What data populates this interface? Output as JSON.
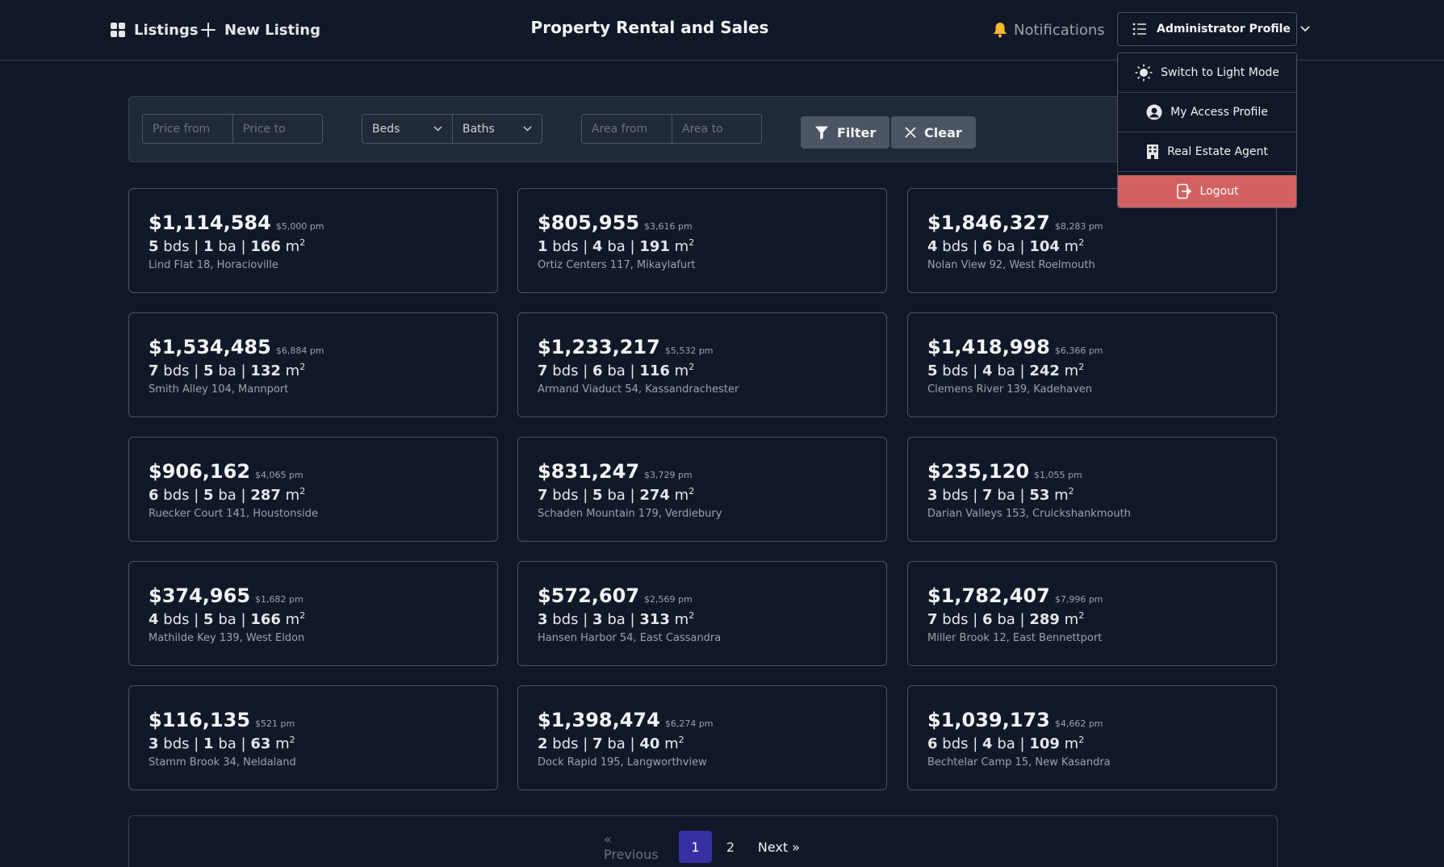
{
  "header": {
    "listings_label": "Listings",
    "new_listing_label": "New Listing",
    "title": "Property Rental and Sales",
    "notifications_label": "Notifications",
    "profile_label": "Administrator Profile"
  },
  "profile_menu": {
    "items": [
      {
        "label": "Switch to Light Mode",
        "icon": "sun-icon"
      },
      {
        "label": "My Access Profile",
        "icon": "user-circle-icon"
      },
      {
        "label": "Real Estate Agent",
        "icon": "building-icon"
      }
    ],
    "logout_label": "Logout"
  },
  "filters": {
    "price_from_placeholder": "Price from",
    "price_to_placeholder": "Price to",
    "beds_label": "Beds",
    "baths_label": "Baths",
    "area_from_placeholder": "Area from",
    "area_to_placeholder": "Area to",
    "filter_label": "Filter",
    "clear_label": "Clear"
  },
  "listings": [
    {
      "price": "$1,114,584",
      "rent": "$5,000 pm",
      "beds": "5",
      "baths": "1",
      "area": "166",
      "address": "Lind Flat 18, Horacioville"
    },
    {
      "price": "$805,955",
      "rent": "$3,616 pm",
      "beds": "1",
      "baths": "4",
      "area": "191",
      "address": "Ortiz Centers 117, Mikaylafurt"
    },
    {
      "price": "$1,846,327",
      "rent": "$8,283 pm",
      "beds": "4",
      "baths": "6",
      "area": "104",
      "address": "Nolan View 92, West Roelmouth"
    },
    {
      "price": "$1,534,485",
      "rent": "$6,884 pm",
      "beds": "7",
      "baths": "5",
      "area": "132",
      "address": "Smith Alley 104, Mannport"
    },
    {
      "price": "$1,233,217",
      "rent": "$5,532 pm",
      "beds": "7",
      "baths": "6",
      "area": "116",
      "address": "Armand Viaduct 54, Kassandrachester"
    },
    {
      "price": "$1,418,998",
      "rent": "$6,366 pm",
      "beds": "5",
      "baths": "4",
      "area": "242",
      "address": "Clemens River 139, Kadehaven"
    },
    {
      "price": "$906,162",
      "rent": "$4,065 pm",
      "beds": "6",
      "baths": "5",
      "area": "287",
      "address": "Ruecker Court 141, Houstonside"
    },
    {
      "price": "$831,247",
      "rent": "$3,729 pm",
      "beds": "7",
      "baths": "5",
      "area": "274",
      "address": "Schaden Mountain 179, Verdiebury"
    },
    {
      "price": "$235,120",
      "rent": "$1,055 pm",
      "beds": "3",
      "baths": "7",
      "area": "53",
      "address": "Darian Valleys 153, Cruickshankmouth"
    },
    {
      "price": "$374,965",
      "rent": "$1,682 pm",
      "beds": "4",
      "baths": "5",
      "area": "166",
      "address": "Mathilde Key 139, West Eldon"
    },
    {
      "price": "$572,607",
      "rent": "$2,569 pm",
      "beds": "3",
      "baths": "3",
      "area": "313",
      "address": "Hansen Harbor 54, East Cassandra"
    },
    {
      "price": "$1,782,407",
      "rent": "$7,996 pm",
      "beds": "7",
      "baths": "6",
      "area": "289",
      "address": "Miller Brook 12, East Bennettport"
    },
    {
      "price": "$116,135",
      "rent": "$521 pm",
      "beds": "3",
      "baths": "1",
      "area": "63",
      "address": "Stamm Brook 34, Neldaland"
    },
    {
      "price": "$1,398,474",
      "rent": "$6,274 pm",
      "beds": "2",
      "baths": "7",
      "area": "40",
      "address": "Dock Rapid 195, Langworthview"
    },
    {
      "price": "$1,039,173",
      "rent": "$4,662 pm",
      "beds": "6",
      "baths": "4",
      "area": "109",
      "address": "Bechtelar Camp 15, New Kasandra"
    }
  ],
  "units": {
    "beds": "bds",
    "baths": "ba",
    "separator": "|",
    "area": "m",
    "area_exp": "2"
  },
  "pagination": {
    "previous_label": "« Previous",
    "pages": [
      "1",
      "2"
    ],
    "current": "1",
    "next_label": "Next »"
  },
  "colors": {
    "background": "#111827",
    "surface": "#1f2937",
    "active_page": "#3730a3",
    "logout": "#d26262",
    "notification_bell": "#f5b82e"
  }
}
